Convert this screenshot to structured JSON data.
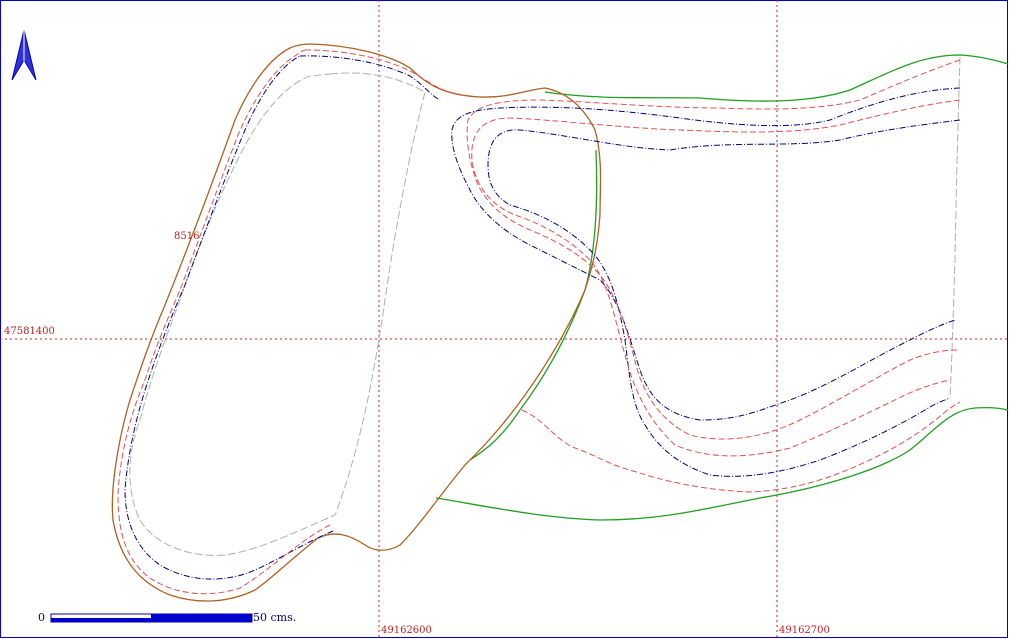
{
  "map": {
    "grid_labels": {
      "x1": "49162600",
      "x2": "49162700",
      "y1": "47581400"
    },
    "contour_label": "8516",
    "scale": {
      "start_label": "0",
      "end_label": "50 cms."
    },
    "north_arrow": "north-arrow-icon",
    "colors": {
      "frame": "#0000cc",
      "grid": "#cc2222",
      "boundary_brown": "#b06020",
      "contour_blue": "#000080",
      "contour_red": "#e05050",
      "contour_gray": "#b0b0b0",
      "green_line": "#20a020"
    }
  }
}
